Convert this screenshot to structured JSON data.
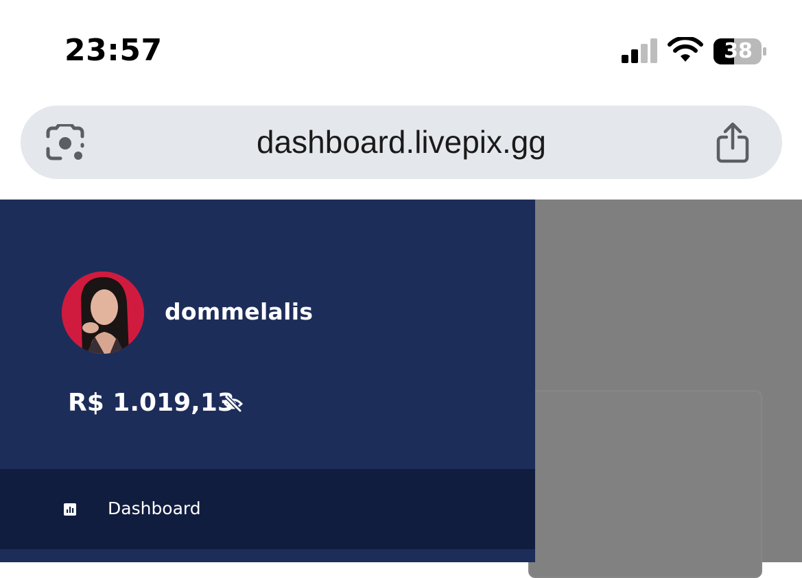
{
  "status_bar": {
    "time": "23:57",
    "battery_level": "38",
    "icons": [
      "signal-icon",
      "wifi-icon",
      "battery-icon"
    ]
  },
  "browser": {
    "url": "dashboard.livepix.gg",
    "icons": [
      "camera-search-icon",
      "share-icon"
    ]
  },
  "sidebar": {
    "username": "dommelalis",
    "balance": "R$ 1.019,13",
    "balance_toggle_icon": "eye-slash-icon",
    "nav_items": [
      {
        "label": "Dashboard",
        "icon": "chart-icon",
        "active": true
      }
    ]
  },
  "colors": {
    "sidebar_bg": "#1d2d5a",
    "nav_active_bg": "#111d3e",
    "overlay": "#7f7f7f",
    "url_bar_bg": "#e4e7eb",
    "avatar_bg": "#d21a3f"
  }
}
